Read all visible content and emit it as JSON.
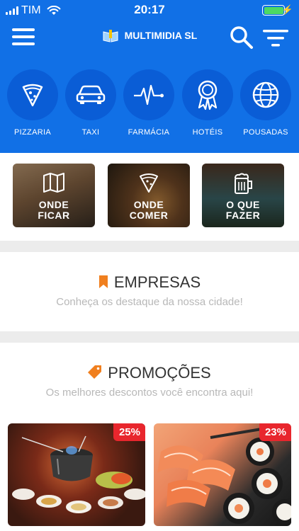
{
  "status_bar": {
    "carrier": "TIM",
    "time": "20:17",
    "battery_color": "#4cd964"
  },
  "header": {
    "brand": "MULTIMIDIA SL",
    "background_color": "#1170e6",
    "menu_icon": "hamburger-icon",
    "search_icon": "search-icon",
    "filter_icon": "filter-icon"
  },
  "categories": [
    {
      "label": "PIZZARIA",
      "icon": "pizza-icon"
    },
    {
      "label": "TAXI",
      "icon": "car-icon"
    },
    {
      "label": "FARMÁCIA",
      "icon": "heartbeat-icon"
    },
    {
      "label": "HOTÉIS",
      "icon": "award-ribbon-icon"
    },
    {
      "label": "POUSADAS",
      "icon": "globe-icon"
    }
  ],
  "tiles": [
    {
      "line1": "ONDE",
      "line2": "FICAR",
      "icon": "map-icon"
    },
    {
      "line1": "ONDE",
      "line2": "COMER",
      "icon": "pizza-icon"
    },
    {
      "line1": "O QUE",
      "line2": "FAZER",
      "icon": "beer-mug-icon"
    }
  ],
  "empresas": {
    "title": "EMPRESAS",
    "subtitle": "Conheça os destaque da nossa cidade!",
    "icon": "bookmark-icon",
    "icon_color": "#f07f1e"
  },
  "promocoes": {
    "title": "PROMOÇÕES",
    "subtitle": "Os melhores descontos você encontra aqui!",
    "icon": "tag-icon",
    "icon_color": "#f07f1e",
    "items": [
      {
        "discount": "25%"
      },
      {
        "discount": "23%"
      }
    ],
    "badge_color": "#e8262d"
  }
}
